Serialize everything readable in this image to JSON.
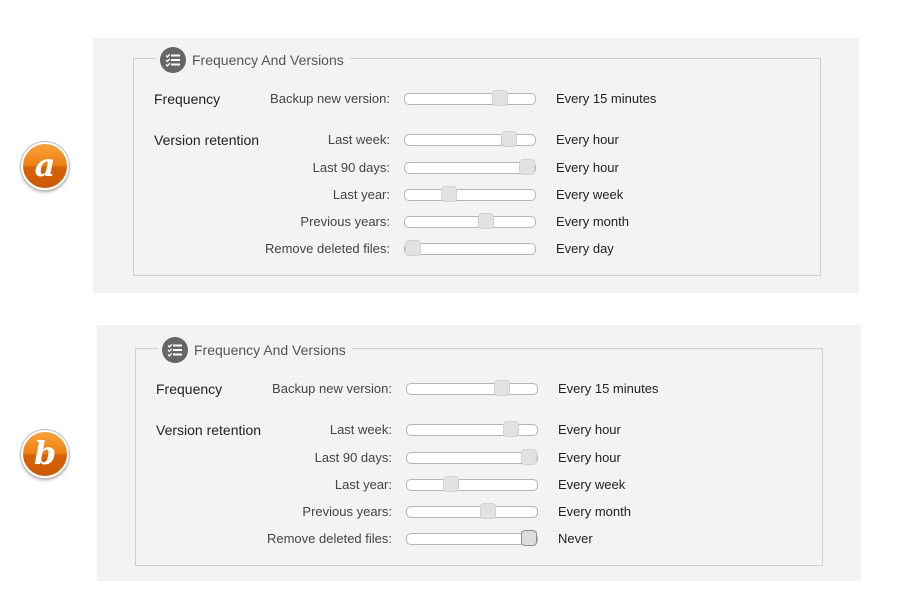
{
  "badges": {
    "a": "a",
    "b": "b"
  },
  "panels": [
    {
      "id": "a",
      "legend_title": "Frequency And Versions",
      "legend_icon": "checklist-icon",
      "frequency_label": "Frequency",
      "retention_label": "Version retention",
      "rows": [
        {
          "label": "Backup new version:",
          "value": "Every 15 minutes",
          "level": 0.76
        },
        {
          "label": "Last week:",
          "value": "Every hour",
          "level": 0.84
        },
        {
          "label": "Last 90 days:",
          "value": "Every hour",
          "level": 1.0
        },
        {
          "label": "Last year:",
          "value": "Every week",
          "level": 0.32
        },
        {
          "label": "Previous years:",
          "value": "Every month",
          "level": 0.64
        },
        {
          "label": "Remove deleted files:",
          "value": "Every day",
          "level": 0.0
        }
      ]
    },
    {
      "id": "b",
      "legend_title": "Frequency And Versions",
      "legend_icon": "checklist-icon",
      "frequency_label": "Frequency",
      "retention_label": "Version retention",
      "rows": [
        {
          "label": "Backup new version:",
          "value": "Every 15 minutes",
          "level": 0.76
        },
        {
          "label": "Last week:",
          "value": "Every hour",
          "level": 0.84
        },
        {
          "label": "Last 90 days:",
          "value": "Every hour",
          "level": 1.0
        },
        {
          "label": "Last year:",
          "value": "Every week",
          "level": 0.32
        },
        {
          "label": "Previous years:",
          "value": "Every month",
          "level": 0.64
        },
        {
          "label": "Remove deleted files:",
          "value": "Never",
          "level": 1.0
        }
      ]
    }
  ]
}
